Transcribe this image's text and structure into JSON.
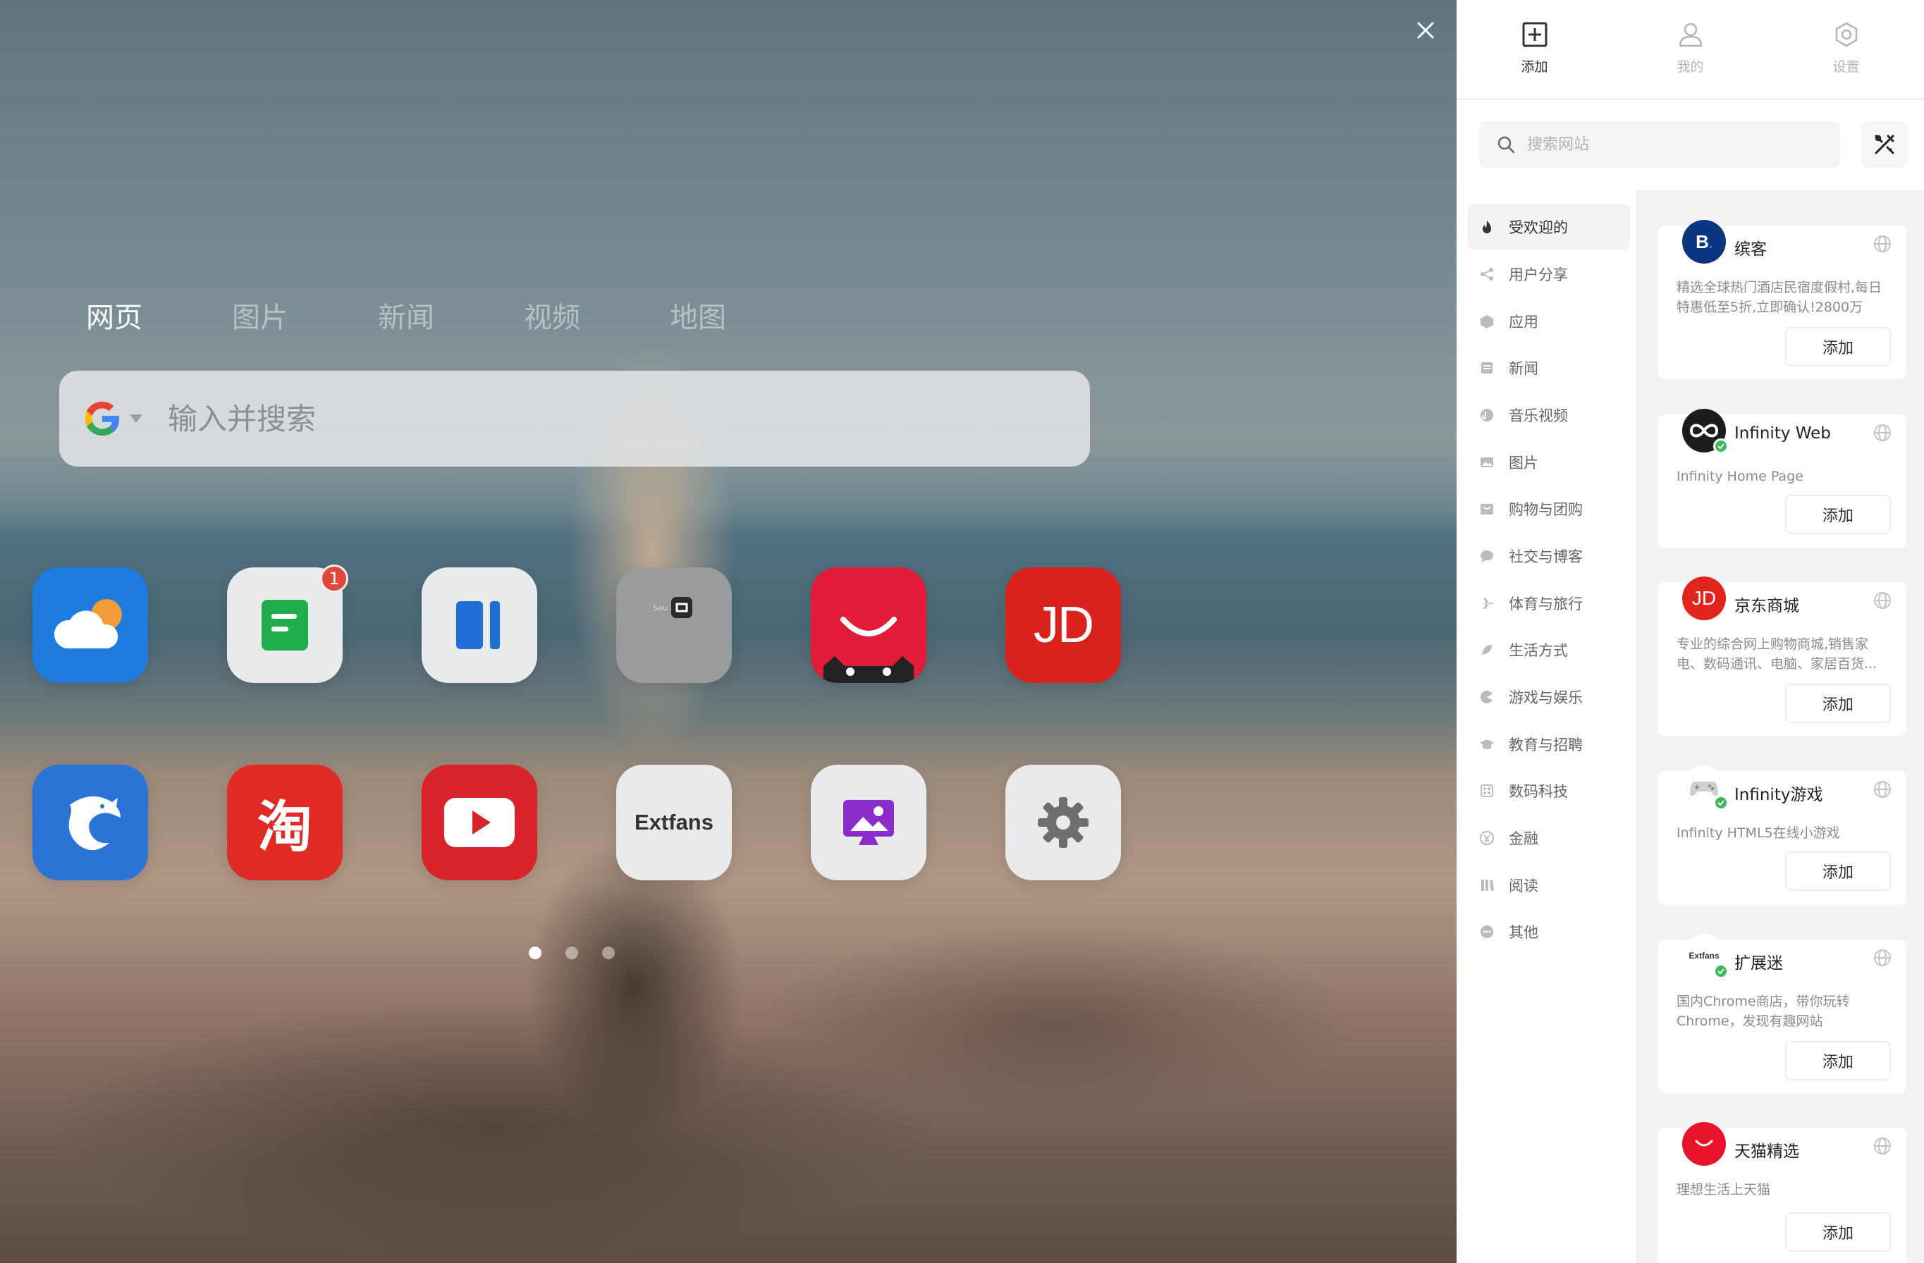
{
  "search": {
    "tabs": [
      "网页",
      "图片",
      "新闻",
      "视频",
      "地图"
    ],
    "active_tab": 0,
    "placeholder": "输入并搜索",
    "engine": "google-icon"
  },
  "apps": [
    {
      "name": "weather-app-icon",
      "bg": "#1e7be0"
    },
    {
      "name": "notes-app-icon",
      "bg": "#e9eaeb",
      "badge": "1"
    },
    {
      "name": "reader-app-icon",
      "bg": "#e9eaeb"
    },
    {
      "name": "app-folder-icon",
      "bg": "#9a9b9c"
    },
    {
      "name": "tmall-app-icon",
      "bg": "#e21c38"
    },
    {
      "name": "jd-app-icon",
      "bg": "#d9221e",
      "label": "JD"
    },
    {
      "name": "dolphin-app-icon",
      "bg": "#2b74d6"
    },
    {
      "name": "taobao-app-icon",
      "bg": "#e02a26",
      "label": "淘"
    },
    {
      "name": "youtube-app-icon",
      "bg": "#d8232a"
    },
    {
      "name": "extfans-app-icon",
      "bg": "#e9eaeb",
      "label": "Extfans"
    },
    {
      "name": "wallpaper-app-icon",
      "bg": "#e9eaeb"
    },
    {
      "name": "settings-app-icon",
      "bg": "#e9eaeb"
    }
  ],
  "pages": {
    "count": 3,
    "active": 0
  },
  "panel": {
    "tabs": [
      {
        "icon": "add-square-icon",
        "label": "添加"
      },
      {
        "icon": "user-icon",
        "label": "我的"
      },
      {
        "icon": "settings-hex-icon",
        "label": "设置"
      }
    ],
    "active_tab": 0,
    "site_search_placeholder": "搜索网站",
    "categories": [
      {
        "icon": "fire-icon",
        "label": "受欢迎的"
      },
      {
        "icon": "share-icon",
        "label": "用户分享"
      },
      {
        "icon": "cube-icon",
        "label": "应用"
      },
      {
        "icon": "news-icon",
        "label": "新闻"
      },
      {
        "icon": "music-icon",
        "label": "音乐视频"
      },
      {
        "icon": "image-icon",
        "label": "图片"
      },
      {
        "icon": "shopping-icon",
        "label": "购物与团购"
      },
      {
        "icon": "chat-icon",
        "label": "社交与博客"
      },
      {
        "icon": "plane-icon",
        "label": "体育与旅行"
      },
      {
        "icon": "lifestyle-icon",
        "label": "生活方式"
      },
      {
        "icon": "game-icon",
        "label": "游戏与娱乐"
      },
      {
        "icon": "education-icon",
        "label": "教育与招聘"
      },
      {
        "icon": "tech-icon",
        "label": "数码科技"
      },
      {
        "icon": "finance-icon",
        "label": "金融"
      },
      {
        "icon": "reading-icon",
        "label": "阅读"
      },
      {
        "icon": "more-icon",
        "label": "其他"
      }
    ],
    "active_category": 0,
    "sites": [
      {
        "name": "缤客",
        "desc": "精选全球热门酒店民宿度假村,每日特惠低至5折,立即确认!2800万全...",
        "add": "添加",
        "logo": "booking-logo-icon",
        "logo_bg": "#0b3580",
        "verified": false
      },
      {
        "name": "Infinity Web",
        "desc": "Infinity Home Page",
        "add": "添加",
        "logo": "infinity-logo-icon",
        "logo_bg": "#1c1c1c",
        "verified": true
      },
      {
        "name": "京东商城",
        "desc": "专业的综合网上购物商城,销售家电、数码通讯、电脑、家居百货...",
        "add": "添加",
        "logo": "jd-logo-icon",
        "logo_bg": "#e1251b",
        "verified": false
      },
      {
        "name": "Infinity游戏",
        "desc": "Infinity HTML5在线小游戏",
        "add": "添加",
        "logo": "gamepad-logo-icon",
        "logo_bg": "#ffffff",
        "verified": true
      },
      {
        "name": "扩展迷",
        "desc": "国内Chrome商店，带你玩转Chrome，发现有趣网站",
        "add": "添加",
        "logo": "extfans-logo-icon",
        "logo_bg": "#ffffff",
        "verified": true
      },
      {
        "name": "天猫精选",
        "desc": "理想生活上天猫",
        "add": "添加",
        "logo": "tmall-logo-icon",
        "logo_bg": "#e8142c",
        "verified": false
      }
    ]
  }
}
